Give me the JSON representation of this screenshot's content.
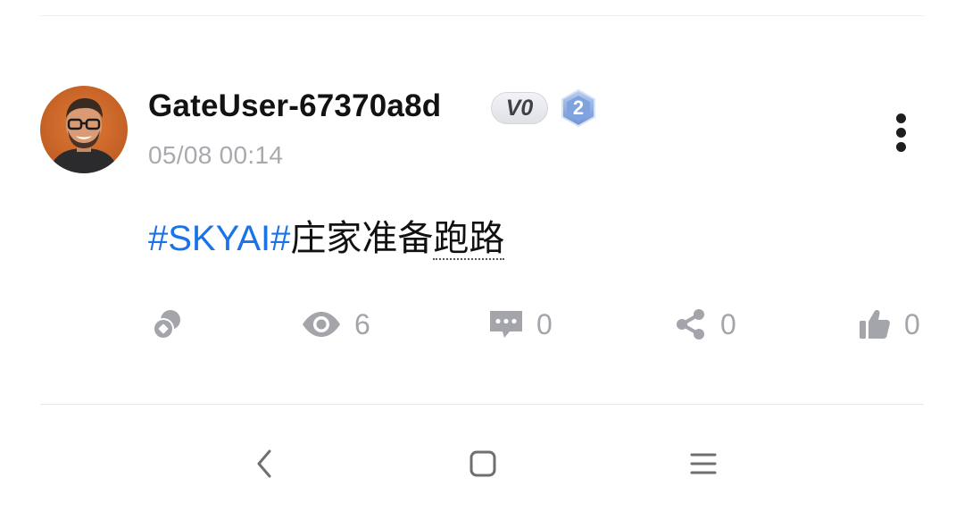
{
  "post": {
    "author": {
      "username": "GateUser-67370a8d",
      "vip_label": "V0",
      "level": "2"
    },
    "timestamp": "05/08 00:14",
    "content": {
      "hashtag": "#SKYAI#",
      "text_main": "庄家准备",
      "text_underlined": "跑路"
    },
    "actions": [
      {
        "name": "tip",
        "icon": "coin-icon",
        "count": ""
      },
      {
        "name": "views",
        "icon": "eye-icon",
        "count": "6"
      },
      {
        "name": "comments",
        "icon": "comment-icon",
        "count": "0"
      },
      {
        "name": "shares",
        "icon": "share-icon",
        "count": "0"
      },
      {
        "name": "likes",
        "icon": "thumbs-up-icon",
        "count": "0"
      }
    ]
  },
  "navigation_bar": {
    "buttons": [
      "back-icon",
      "home-icon",
      "recents-icon"
    ]
  },
  "colors": {
    "hashtag": "#1a73e8",
    "icon_gray": "#a3a5ab",
    "timestamp_gray": "#a9aab0",
    "level_badge": "#7fa3de"
  }
}
